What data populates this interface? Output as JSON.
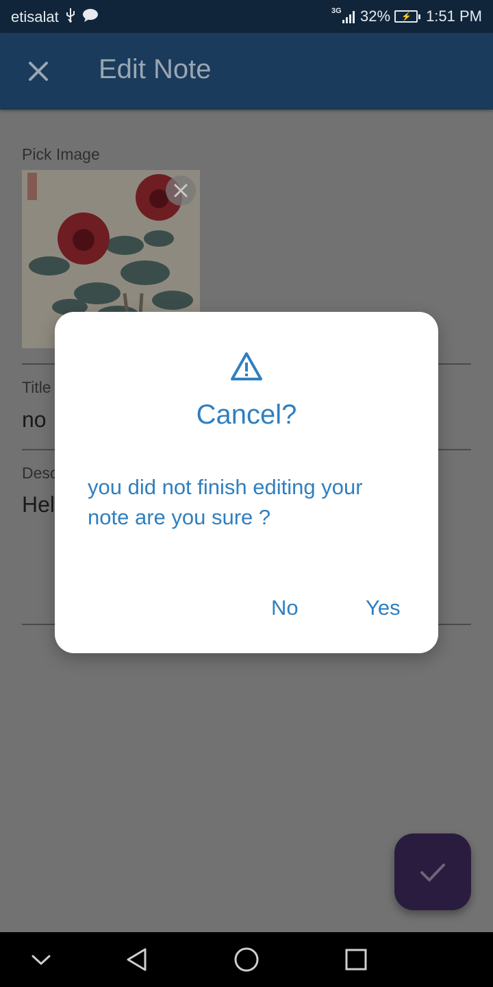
{
  "status_bar": {
    "carrier": "etisalat",
    "network": "3G",
    "battery": "32%",
    "time": "1:51 PM",
    "icons": [
      "usb-icon",
      "message-icon",
      "signal-icon",
      "battery-charging-icon"
    ]
  },
  "app_bar": {
    "title": "Edit Note",
    "close_icon": "close-icon"
  },
  "form": {
    "pick_image_label": "Pick Image",
    "title_label": "Title",
    "title_value": "no",
    "description_label": "Desc",
    "description_value": "Hel"
  },
  "dialog": {
    "icon": "warning-icon",
    "title": "Cancel?",
    "message": "you did not finish editing your note are you sure ?",
    "no_label": "No",
    "yes_label": "Yes"
  },
  "fab": {
    "icon": "check-icon"
  },
  "nav_bar": {
    "icons": [
      "chevron-down-icon",
      "back-icon",
      "home-icon",
      "recents-icon"
    ]
  },
  "colors": {
    "accent": "#2f7fbf",
    "app_bar": "#1a3b5b",
    "status_bar": "#10253a",
    "scrim": "#727272",
    "fab": "#2a1c3e"
  }
}
